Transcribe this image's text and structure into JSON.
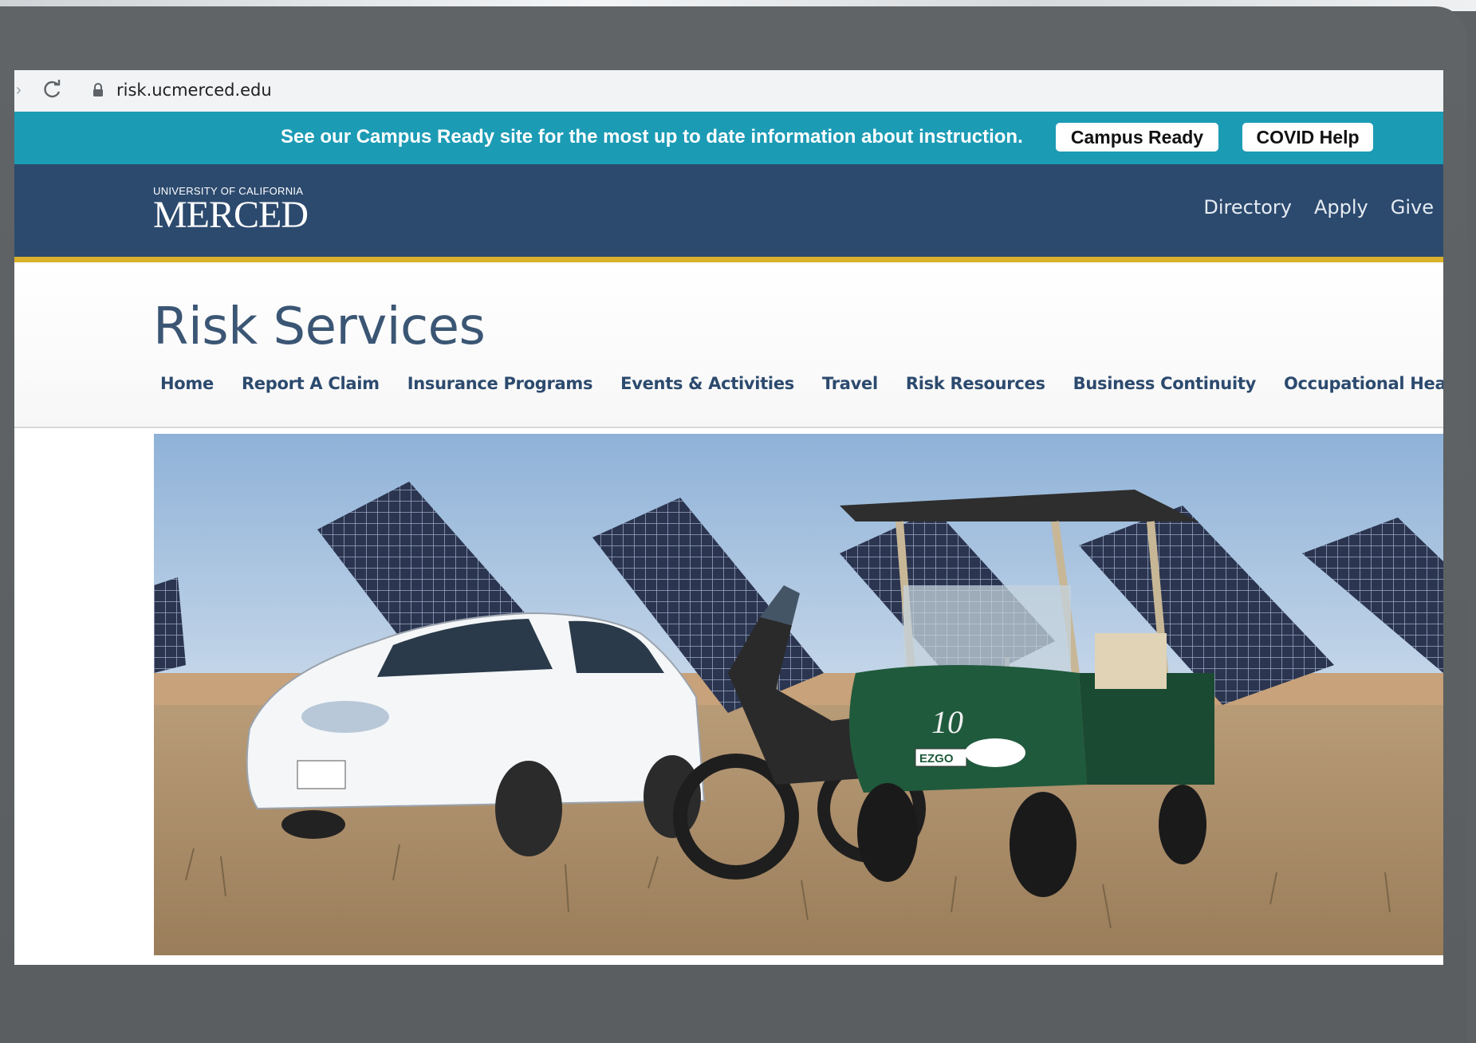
{
  "browser": {
    "url": "risk.ucmerced.edu"
  },
  "alert": {
    "message": "See our Campus Ready site for the most up to date information about instruction.",
    "campus_ready_label": "Campus Ready",
    "covid_help_label": "COVID Help"
  },
  "header": {
    "logo_small": "UNIVERSITY OF CALIFORNIA",
    "logo_big": "MERCED",
    "utility_links": [
      "Directory",
      "Apply",
      "Give"
    ]
  },
  "page": {
    "title": "Risk Services"
  },
  "nav": {
    "items": [
      "Home",
      "Report A Claim",
      "Insurance Programs",
      "Events & Activities",
      "Travel",
      "Risk Resources",
      "Business Continuity",
      "Occupational Health"
    ]
  },
  "hero": {
    "cart_text": "10",
    "cart_brand": "EZGO"
  },
  "colors": {
    "alert_bg": "#1c9bb5",
    "header_bg": "#2c4a6e",
    "header_accent": "#d9b12a",
    "title_color": "#3b5674"
  }
}
